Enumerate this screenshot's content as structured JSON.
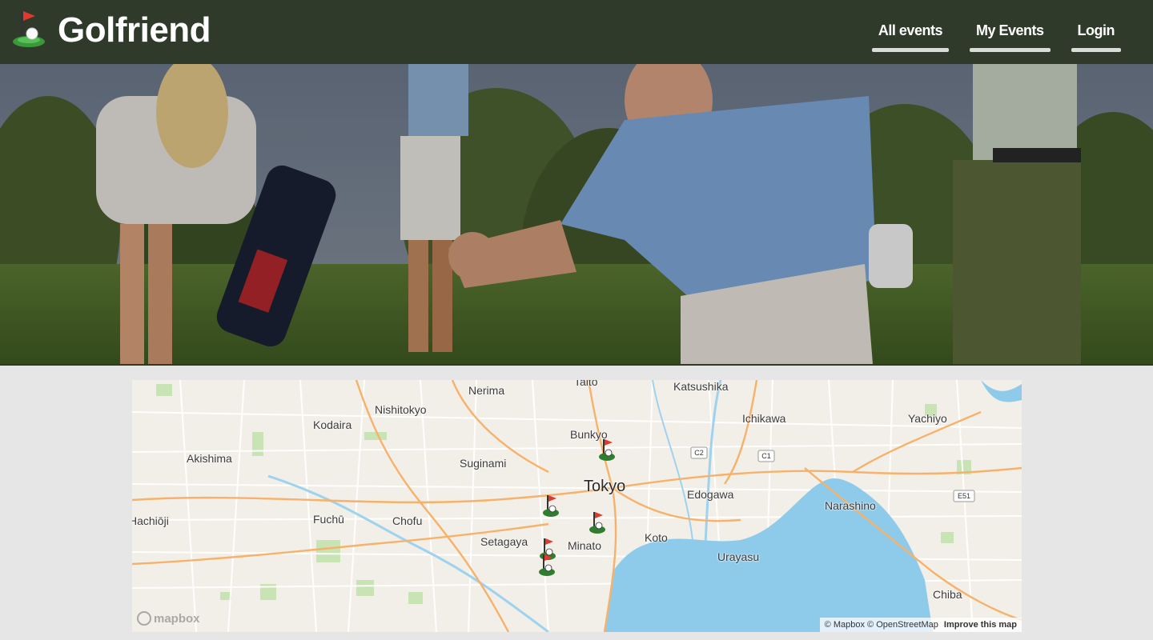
{
  "navbar": {
    "brand": "Golfriend",
    "links": [
      {
        "label": "All events"
      },
      {
        "label": "My Events"
      },
      {
        "label": "Login"
      }
    ]
  },
  "map": {
    "labels": {
      "nerima": "Nerima",
      "katsushika": "Katsushika",
      "nishitokyo": "Nishitokyo",
      "kodaira": "Kodaira",
      "ichikawa": "Ichikawa",
      "yachiyo": "Yachiyo",
      "bunkyo": "Bunkyo",
      "akishima": "Akishima",
      "suginami": "Suginami",
      "tokyo": "Tokyo",
      "edogawa": "Edogawa",
      "narashino": "Narashino",
      "hachioji": "Hachiōji",
      "fuchu": "Fuchū",
      "chofu": "Chofu",
      "setagaya": "Setagaya",
      "minato": "Minato",
      "koto": "Koto",
      "urayasu": "Urayasu",
      "chiba": "Chiba",
      "taito": "Taito"
    },
    "road_shields": [
      "C2",
      "C1",
      "E51"
    ],
    "attribution": {
      "mapbox": "© Mapbox",
      "osm": "© OpenStreetMap",
      "improve": "Improve this map"
    },
    "logo_text": "mapbox",
    "colors": {
      "water": "#8ecbea",
      "land": "#f2efe8",
      "park": "#c8e3b4",
      "road_major": "#f6b26b",
      "road_minor": "#ffffff"
    }
  },
  "colors": {
    "navbar_bg": "#2f3a2b",
    "page_bg": "#e6e6e6"
  }
}
